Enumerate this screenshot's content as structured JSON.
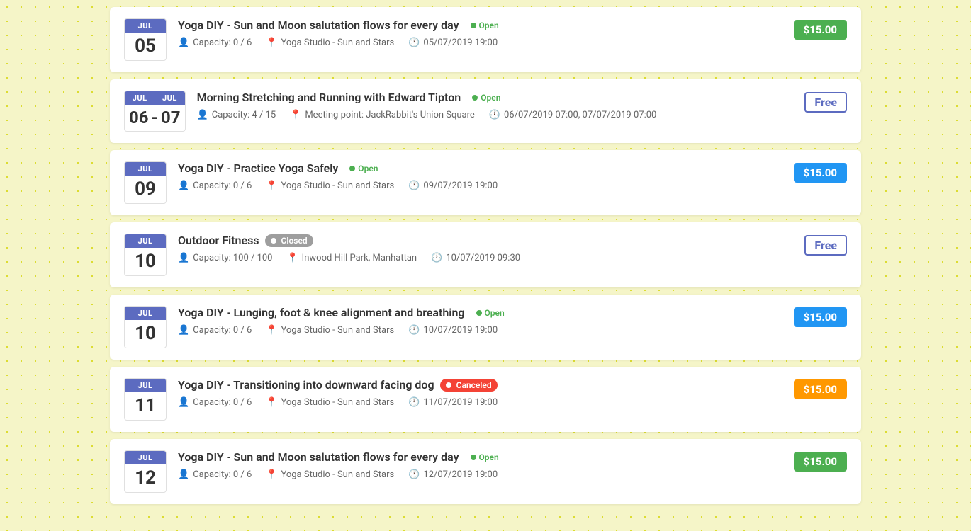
{
  "events": [
    {
      "id": "event-1",
      "month": "JUL",
      "day": "05",
      "double_date": false,
      "title": "Yoga DIY - Sun and Moon salutation flows for every day",
      "status": "open",
      "status_label": "Open",
      "capacity": "Capacity: 0 / 6",
      "location": "Yoga Studio - Sun and Stars",
      "datetime": "05/07/2019 19:00",
      "price_type": "green",
      "price_label": "$15.00"
    },
    {
      "id": "event-2",
      "month1": "JUL",
      "month2": "JUL",
      "day1": "06",
      "day2": "07",
      "double_date": true,
      "title": "Morning Stretching and Running with Edward Tipton",
      "status": "open",
      "status_label": "Open",
      "capacity": "Capacity: 4 / 15",
      "location": "Meeting point: JackRabbit's Union Square",
      "datetime": "06/07/2019 07:00, 07/07/2019 07:00",
      "price_type": "free",
      "price_label": "Free"
    },
    {
      "id": "event-3",
      "month": "JUL",
      "day": "09",
      "double_date": false,
      "title": "Yoga DIY - Practice Yoga Safely",
      "status": "open",
      "status_label": "Open",
      "capacity": "Capacity: 0 / 6",
      "location": "Yoga Studio - Sun and Stars",
      "datetime": "09/07/2019 19:00",
      "price_type": "blue",
      "price_label": "$15.00"
    },
    {
      "id": "event-4",
      "month": "JUL",
      "day": "10",
      "double_date": false,
      "title": "Outdoor Fitness",
      "status": "closed",
      "status_label": "Closed",
      "capacity": "Capacity: 100 / 100",
      "location": "Inwood Hill Park, Manhattan",
      "datetime": "10/07/2019 09:30",
      "price_type": "free",
      "price_label": "Free"
    },
    {
      "id": "event-5",
      "month": "JUL",
      "day": "10",
      "double_date": false,
      "title": "Yoga DIY - Lunging, foot & knee alignment and breathing",
      "status": "open",
      "status_label": "Open",
      "capacity": "Capacity: 0 / 6",
      "location": "Yoga Studio - Sun and Stars",
      "datetime": "10/07/2019 19:00",
      "price_type": "blue",
      "price_label": "$15.00"
    },
    {
      "id": "event-6",
      "month": "JUL",
      "day": "11",
      "double_date": false,
      "title": "Yoga DIY - Transitioning into downward facing dog",
      "status": "canceled",
      "status_label": "Canceled",
      "capacity": "Capacity: 0 / 6",
      "location": "Yoga Studio - Sun and Stars",
      "datetime": "11/07/2019 19:00",
      "price_type": "orange",
      "price_label": "$15.00"
    },
    {
      "id": "event-7",
      "month": "JUL",
      "day": "12",
      "double_date": false,
      "title": "Yoga DIY - Sun and Moon salutation flows for every day",
      "status": "open",
      "status_label": "Open",
      "capacity": "Capacity: 0 / 6",
      "location": "Yoga Studio - Sun and Stars",
      "datetime": "12/07/2019 19:00",
      "price_type": "green",
      "price_label": "$15.00"
    }
  ]
}
